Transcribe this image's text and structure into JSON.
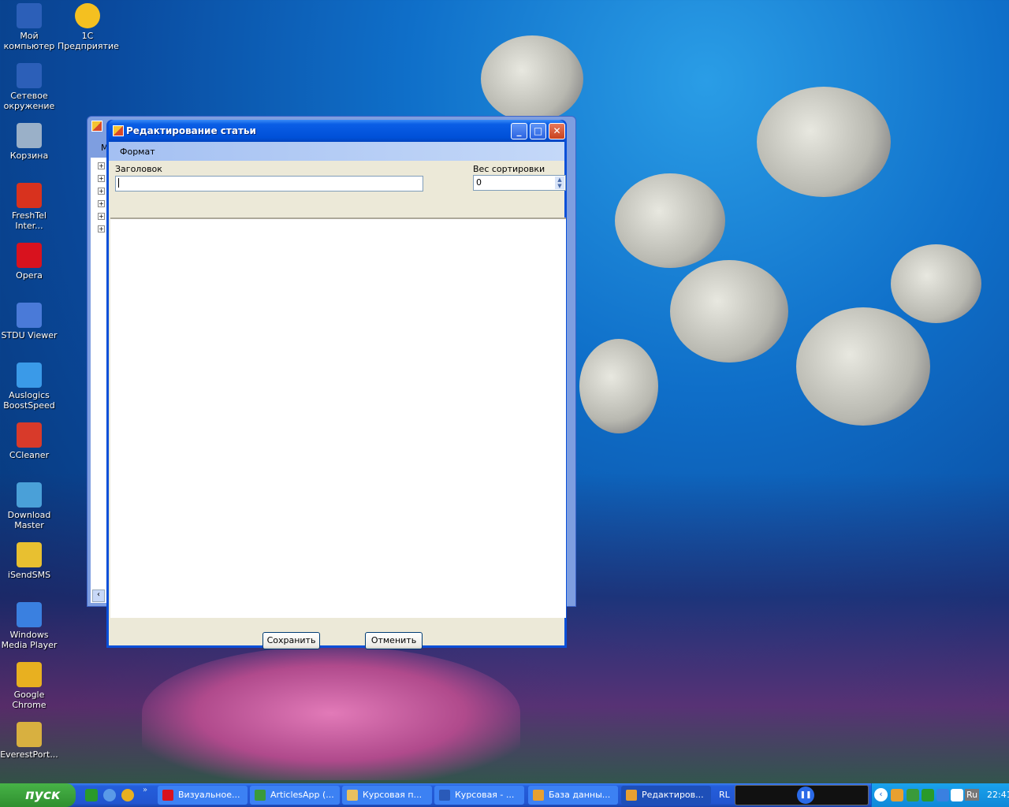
{
  "desktop_icons": [
    {
      "label": "Мой компьютер",
      "color": "#2c5fb8"
    },
    {
      "label": "Сетевое окружение",
      "color": "#2c5fb8"
    },
    {
      "label": "Корзина",
      "color": "#9ab0c8"
    },
    {
      "label": "FreshTel Inter...",
      "color": "#d8321e"
    },
    {
      "label": "Opera",
      "color": "#d8121e"
    },
    {
      "label": "STDU Viewer",
      "color": "#4a7ad8"
    },
    {
      "label": "Auslogics BoostSpeed",
      "color": "#3a9ae8"
    },
    {
      "label": "CCleaner",
      "color": "#d83a2a"
    },
    {
      "label": "Download Master",
      "color": "#4aa0d8"
    },
    {
      "label": "iSendSMS",
      "color": "#e8c030"
    },
    {
      "label": "Windows Media Player",
      "color": "#3a80e0"
    },
    {
      "label": "Google Chrome",
      "color": "#e8b020"
    },
    {
      "label": "EverestPort...",
      "color": "#d8b040"
    }
  ],
  "desktop_icon_1c": {
    "label": "1С Предприятие",
    "color": "#f4c020"
  },
  "background_window": {
    "menu_initial": "М"
  },
  "dialog": {
    "title": "Редактирование статьи",
    "menu": [
      "Формат"
    ],
    "title_label": "Заголовок",
    "title_value": "",
    "sort_label": "Вес сортировки",
    "sort_value": "0",
    "save_label": "Сохранить",
    "cancel_label": "Отменить"
  },
  "taskbar": {
    "start_label": "пуск",
    "buttons": [
      {
        "label": "Визуальное...",
        "color": "#d8121e"
      },
      {
        "label": "ArticlesApp (...",
        "color": "#3a9a3a"
      },
      {
        "label": "Курсовая п...",
        "color": "#e8c060"
      },
      {
        "label": "Курсовая - ...",
        "color": "#2a5ab8"
      },
      {
        "label": "База данны...",
        "color": "#e8a030"
      },
      {
        "label": "Редактиров...",
        "color": "#e8a030"
      }
    ],
    "rl_label": "RL",
    "lang": "Ru",
    "clock": "22:41"
  }
}
